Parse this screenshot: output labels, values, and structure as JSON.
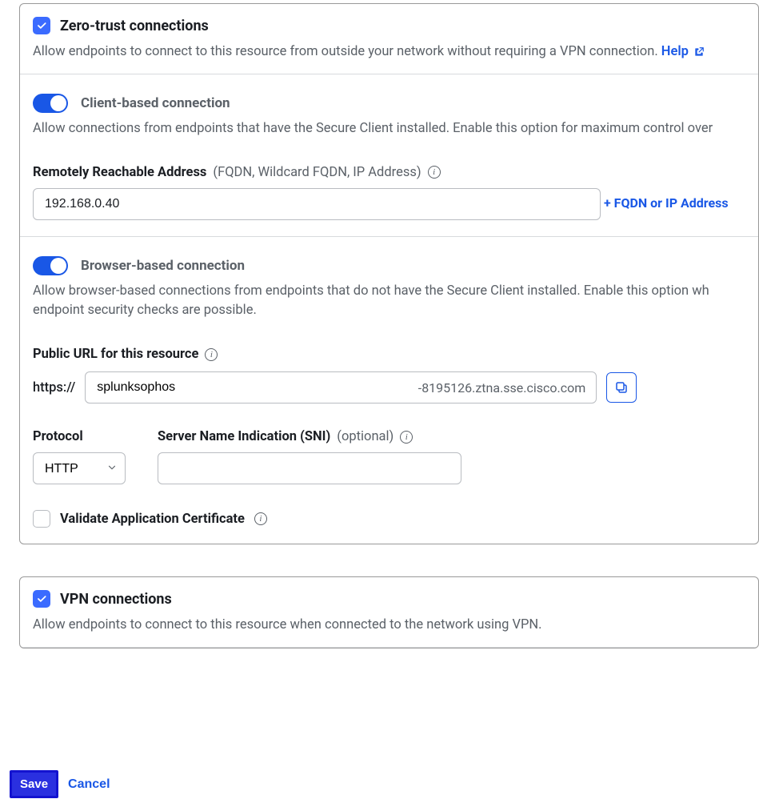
{
  "zeroTrust": {
    "title": "Zero-trust connections",
    "desc": "Allow endpoints to connect to this resource from outside your network without requiring a VPN connection. ",
    "helpLabel": "Help",
    "checked": true
  },
  "clientBased": {
    "title": "Client-based connection",
    "desc": "Allow connections from endpoints that have the Secure Client installed. Enable this option for maximum control over",
    "enabled": true,
    "addressLabel": "Remotely Reachable Address",
    "addressHint": "(FQDN, Wildcard FQDN, IP Address)",
    "addressValue": "192.168.0.40",
    "addLinkLabel": "+ FQDN or IP Address"
  },
  "browserBased": {
    "title": "Browser-based connection",
    "desc": "Allow browser-based connections from endpoints that do not have the Secure Client installed. Enable this option wh endpoint security checks are possible.",
    "enabled": true,
    "publicUrlLabel": "Public URL for this resource",
    "httpsPrefix": "https://",
    "publicUrlValue": "splunksophos",
    "publicUrlSuffix": "-8195126.ztna.sse.cisco.com",
    "protocolLabel": "Protocol",
    "protocolValue": "HTTP",
    "sniLabel": "Server Name Indication (SNI)",
    "sniHint": "(optional)",
    "sniValue": "",
    "validateCertLabel": "Validate Application Certificate",
    "validateCertChecked": false
  },
  "vpn": {
    "title": "VPN connections",
    "desc": "Allow endpoints to connect to this resource when connected to the network using VPN.",
    "checked": true
  },
  "footer": {
    "saveLabel": "Save",
    "cancelLabel": "Cancel"
  }
}
